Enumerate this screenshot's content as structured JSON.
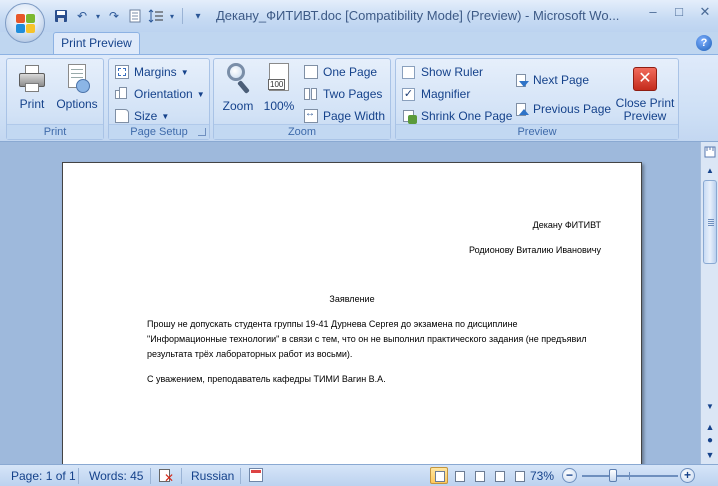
{
  "window": {
    "title": "Декану_ФИТИВТ.doc [Compatibility Mode] (Preview) - Microsoft Wo...",
    "minimize": "–",
    "maximize": "□",
    "close": "✕"
  },
  "quick_access": {
    "icons": [
      "save-icon",
      "undo-icon",
      "redo-icon",
      "print-preview-icon",
      "line-spacing-icon",
      "customize-icon"
    ],
    "undo": "↶",
    "redo": "↷",
    "dropdown": "▾"
  },
  "ribbon": {
    "tab": "Print Preview",
    "help": "?",
    "groups": {
      "print": {
        "label": "Print",
        "print_button": "Print",
        "options_button": "Options"
      },
      "page_setup": {
        "label": "Page Setup",
        "margins": "Margins",
        "orientation": "Orientation",
        "size": "Size"
      },
      "zoom": {
        "label": "Zoom",
        "zoom_button": "Zoom",
        "hundred_button": "100%",
        "hundred_icon_text": "100",
        "one_page": "One Page",
        "two_pages": "Two Pages",
        "page_width": "Page Width"
      },
      "preview": {
        "label": "Preview",
        "show_ruler": "Show Ruler",
        "show_ruler_checked": false,
        "magnifier": "Magnifier",
        "magnifier_checked": true,
        "magnifier_check_glyph": "✓",
        "shrink_one_page": "Shrink One Page",
        "next_page": "Next Page",
        "previous_page": "Previous Page",
        "close_line1": "Close Print",
        "close_line2": "Preview"
      }
    }
  },
  "document": {
    "recipient_title": "Декану ФИТИВТ",
    "recipient_name": "Родионову Виталию Ивановичу",
    "heading": "Заявление",
    "paragraph": "Прошу не допускать студента группы 19-41 Дурнева Сергея до экзамена по дисциплине \"Информационные технологии\" в связи с тем, что он не выполнил практического задания (не предъявил результата трёх лабораторных работ из восьми).",
    "closing": "С уважением, преподаватель кафедры ТИМИ Вагин В.А."
  },
  "scrollbar": {
    "up": "▲",
    "down": "▼",
    "prev_page": "▲",
    "browse": "●",
    "next_page": "▼"
  },
  "statusbar": {
    "page": "Page: 1 of 1",
    "words": "Words: 45",
    "language": "Russian",
    "zoom_level": "73%",
    "zoom_minus": "−",
    "zoom_plus": "+"
  },
  "colors": {
    "ribbon_text": "#15428b",
    "document_background": "#9eb9dc",
    "close_button": "#c42b1c"
  }
}
